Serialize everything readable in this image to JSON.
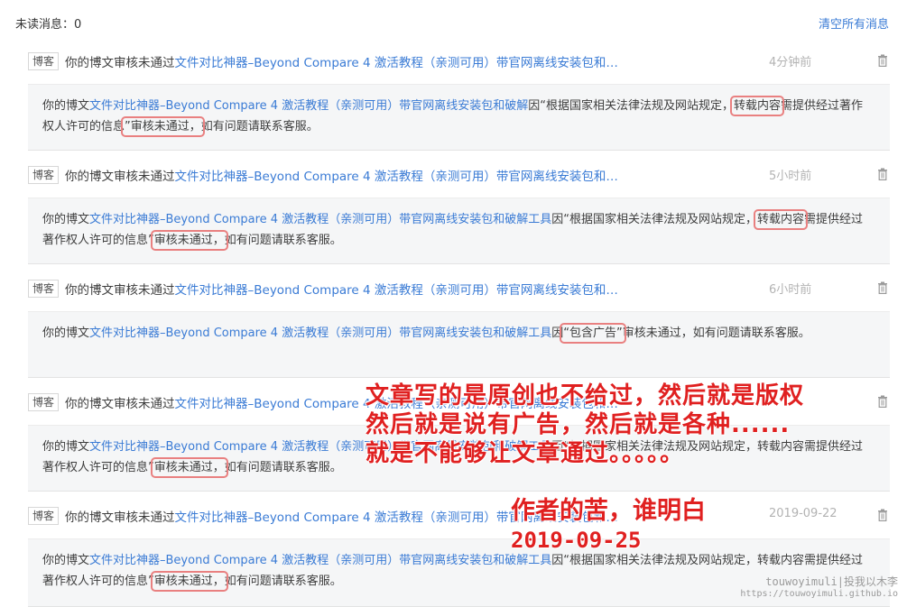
{
  "header": {
    "unread_label": "未读消息：0",
    "clear_all": "清空所有消息"
  },
  "colors": {
    "link": "#3a7bd5",
    "time": "#b3b3b3",
    "highlight_box": "#e98080",
    "overlay_text": "#e02020",
    "body_bg": "#f5f6f7"
  },
  "messages": [
    {
      "tag": "博客",
      "head_prefix": "你的博文审核未通过",
      "head_link": "文件对比神器–Beyond Compare 4 激活教程（亲测可用）带官网离线安装包和…",
      "time": "4分钟前",
      "body_prefix": "你的博文",
      "body_link": "文件对比神器–Beyond Compare 4 激活教程（亲测可用）带官网离线安装包和破解",
      "body_mid": "因“根据国家相关法律法规及网站规定，",
      "body_hl1": "转载内容",
      "body_mid2": "需提供经过著作权人许可的信息",
      "body_hl2": "”审核未通过，",
      "body_end": "如有问题请联系客服。"
    },
    {
      "tag": "博客",
      "head_prefix": "你的博文审核未通过",
      "head_link": "文件对比神器–Beyond Compare 4 激活教程（亲测可用）带官网离线安装包和…",
      "time": "5小时前",
      "body_prefix": "你的博文",
      "body_link": "文件对比神器–Beyond Compare 4 激活教程（亲测可用）带官网离线安装包和破解工具",
      "body_mid": "因“根据国家相关法律法规及网站规定，",
      "body_hl1": "转载内容",
      "body_mid2": "需提供经过著作权人许可的信息”",
      "body_hl2": "审核未通过，",
      "body_end": "如有问题请联系客服。"
    },
    {
      "tag": "博客",
      "head_prefix": "你的博文审核未通过",
      "head_link": "文件对比神器–Beyond Compare 4 激活教程（亲测可用）带官网离线安装包和…",
      "time": "6小时前",
      "body_prefix": "你的博文",
      "body_link": "文件对比神器–Beyond Compare 4 激活教程（亲测可用）带官网离线安装包和破解工具",
      "body_mid": "因",
      "body_hl1": "“包含广告”",
      "body_end": "审核未通过，如有问题请联系客服。"
    },
    {
      "tag": "博客",
      "head_prefix": "你的博文审核未通过",
      "head_link": "文件对比神器–Beyond Compare 4 激活教程（亲测可用）带官网离线安装包和…",
      "time": "",
      "body_prefix": "你的博文",
      "body_link": "文件对比神器–Beyond Compare 4 激活教程（亲测可用）带官网离线安装包和破解工具",
      "body_mid": "因“根据国家相关法律法规及网站规定，转载内容",
      "body_mid2": "需提供经过著作权人许可的信息”",
      "body_hl2": "审核未通过，",
      "body_end": "如有问题请联系客服。"
    },
    {
      "tag": "博客",
      "head_prefix": "你的博文审核未通过",
      "head_link": "文件对比神器–Beyond Compare 4 激活教程（亲测可用）带官网离线安装包和…",
      "time": "2019-09-22",
      "body_prefix": "你的博文",
      "body_link": "文件对比神器–Beyond Compare 4 激活教程（亲测可用）带官网离线安装包和破解工具",
      "body_mid": "因“根据国家相关法律法规及网站规定，转载内容",
      "body_mid2": "需提供经过著作权人许可的信息”",
      "body_hl2": "审核未通过，",
      "body_end": "如有问题请联系客服。"
    }
  ],
  "annotations": {
    "line1": "文章写的是原创也不给过，然后就是版权",
    "line2": "然后就是说有广告，然后就是各种......",
    "line3": "就是不能够让文章通过。。。。。",
    "line4": "作者的苦，谁明白",
    "line5": "2019-09-25"
  },
  "watermark": {
    "line1": "touwoyimuli|投我以木李",
    "line2": "https://touwoyimuli.github.io"
  }
}
